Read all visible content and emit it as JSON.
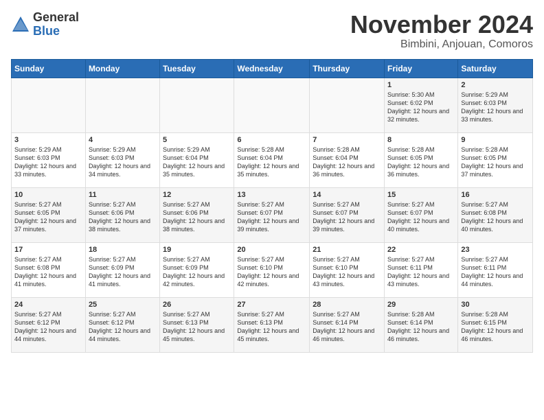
{
  "header": {
    "logo_general": "General",
    "logo_blue": "Blue",
    "month_title": "November 2024",
    "location": "Bimbini, Anjouan, Comoros"
  },
  "weekdays": [
    "Sunday",
    "Monday",
    "Tuesday",
    "Wednesday",
    "Thursday",
    "Friday",
    "Saturday"
  ],
  "weeks": [
    [
      {
        "day": "",
        "info": ""
      },
      {
        "day": "",
        "info": ""
      },
      {
        "day": "",
        "info": ""
      },
      {
        "day": "",
        "info": ""
      },
      {
        "day": "",
        "info": ""
      },
      {
        "day": "1",
        "info": "Sunrise: 5:30 AM\nSunset: 6:02 PM\nDaylight: 12 hours and 32 minutes."
      },
      {
        "day": "2",
        "info": "Sunrise: 5:29 AM\nSunset: 6:03 PM\nDaylight: 12 hours and 33 minutes."
      }
    ],
    [
      {
        "day": "3",
        "info": "Sunrise: 5:29 AM\nSunset: 6:03 PM\nDaylight: 12 hours and 33 minutes."
      },
      {
        "day": "4",
        "info": "Sunrise: 5:29 AM\nSunset: 6:03 PM\nDaylight: 12 hours and 34 minutes."
      },
      {
        "day": "5",
        "info": "Sunrise: 5:29 AM\nSunset: 6:04 PM\nDaylight: 12 hours and 35 minutes."
      },
      {
        "day": "6",
        "info": "Sunrise: 5:28 AM\nSunset: 6:04 PM\nDaylight: 12 hours and 35 minutes."
      },
      {
        "day": "7",
        "info": "Sunrise: 5:28 AM\nSunset: 6:04 PM\nDaylight: 12 hours and 36 minutes."
      },
      {
        "day": "8",
        "info": "Sunrise: 5:28 AM\nSunset: 6:05 PM\nDaylight: 12 hours and 36 minutes."
      },
      {
        "day": "9",
        "info": "Sunrise: 5:28 AM\nSunset: 6:05 PM\nDaylight: 12 hours and 37 minutes."
      }
    ],
    [
      {
        "day": "10",
        "info": "Sunrise: 5:27 AM\nSunset: 6:05 PM\nDaylight: 12 hours and 37 minutes."
      },
      {
        "day": "11",
        "info": "Sunrise: 5:27 AM\nSunset: 6:06 PM\nDaylight: 12 hours and 38 minutes."
      },
      {
        "day": "12",
        "info": "Sunrise: 5:27 AM\nSunset: 6:06 PM\nDaylight: 12 hours and 38 minutes."
      },
      {
        "day": "13",
        "info": "Sunrise: 5:27 AM\nSunset: 6:07 PM\nDaylight: 12 hours and 39 minutes."
      },
      {
        "day": "14",
        "info": "Sunrise: 5:27 AM\nSunset: 6:07 PM\nDaylight: 12 hours and 39 minutes."
      },
      {
        "day": "15",
        "info": "Sunrise: 5:27 AM\nSunset: 6:07 PM\nDaylight: 12 hours and 40 minutes."
      },
      {
        "day": "16",
        "info": "Sunrise: 5:27 AM\nSunset: 6:08 PM\nDaylight: 12 hours and 40 minutes."
      }
    ],
    [
      {
        "day": "17",
        "info": "Sunrise: 5:27 AM\nSunset: 6:08 PM\nDaylight: 12 hours and 41 minutes."
      },
      {
        "day": "18",
        "info": "Sunrise: 5:27 AM\nSunset: 6:09 PM\nDaylight: 12 hours and 41 minutes."
      },
      {
        "day": "19",
        "info": "Sunrise: 5:27 AM\nSunset: 6:09 PM\nDaylight: 12 hours and 42 minutes."
      },
      {
        "day": "20",
        "info": "Sunrise: 5:27 AM\nSunset: 6:10 PM\nDaylight: 12 hours and 42 minutes."
      },
      {
        "day": "21",
        "info": "Sunrise: 5:27 AM\nSunset: 6:10 PM\nDaylight: 12 hours and 43 minutes."
      },
      {
        "day": "22",
        "info": "Sunrise: 5:27 AM\nSunset: 6:11 PM\nDaylight: 12 hours and 43 minutes."
      },
      {
        "day": "23",
        "info": "Sunrise: 5:27 AM\nSunset: 6:11 PM\nDaylight: 12 hours and 44 minutes."
      }
    ],
    [
      {
        "day": "24",
        "info": "Sunrise: 5:27 AM\nSunset: 6:12 PM\nDaylight: 12 hours and 44 minutes."
      },
      {
        "day": "25",
        "info": "Sunrise: 5:27 AM\nSunset: 6:12 PM\nDaylight: 12 hours and 44 minutes."
      },
      {
        "day": "26",
        "info": "Sunrise: 5:27 AM\nSunset: 6:13 PM\nDaylight: 12 hours and 45 minutes."
      },
      {
        "day": "27",
        "info": "Sunrise: 5:27 AM\nSunset: 6:13 PM\nDaylight: 12 hours and 45 minutes."
      },
      {
        "day": "28",
        "info": "Sunrise: 5:27 AM\nSunset: 6:14 PM\nDaylight: 12 hours and 46 minutes."
      },
      {
        "day": "29",
        "info": "Sunrise: 5:28 AM\nSunset: 6:14 PM\nDaylight: 12 hours and 46 minutes."
      },
      {
        "day": "30",
        "info": "Sunrise: 5:28 AM\nSunset: 6:15 PM\nDaylight: 12 hours and 46 minutes."
      }
    ]
  ]
}
